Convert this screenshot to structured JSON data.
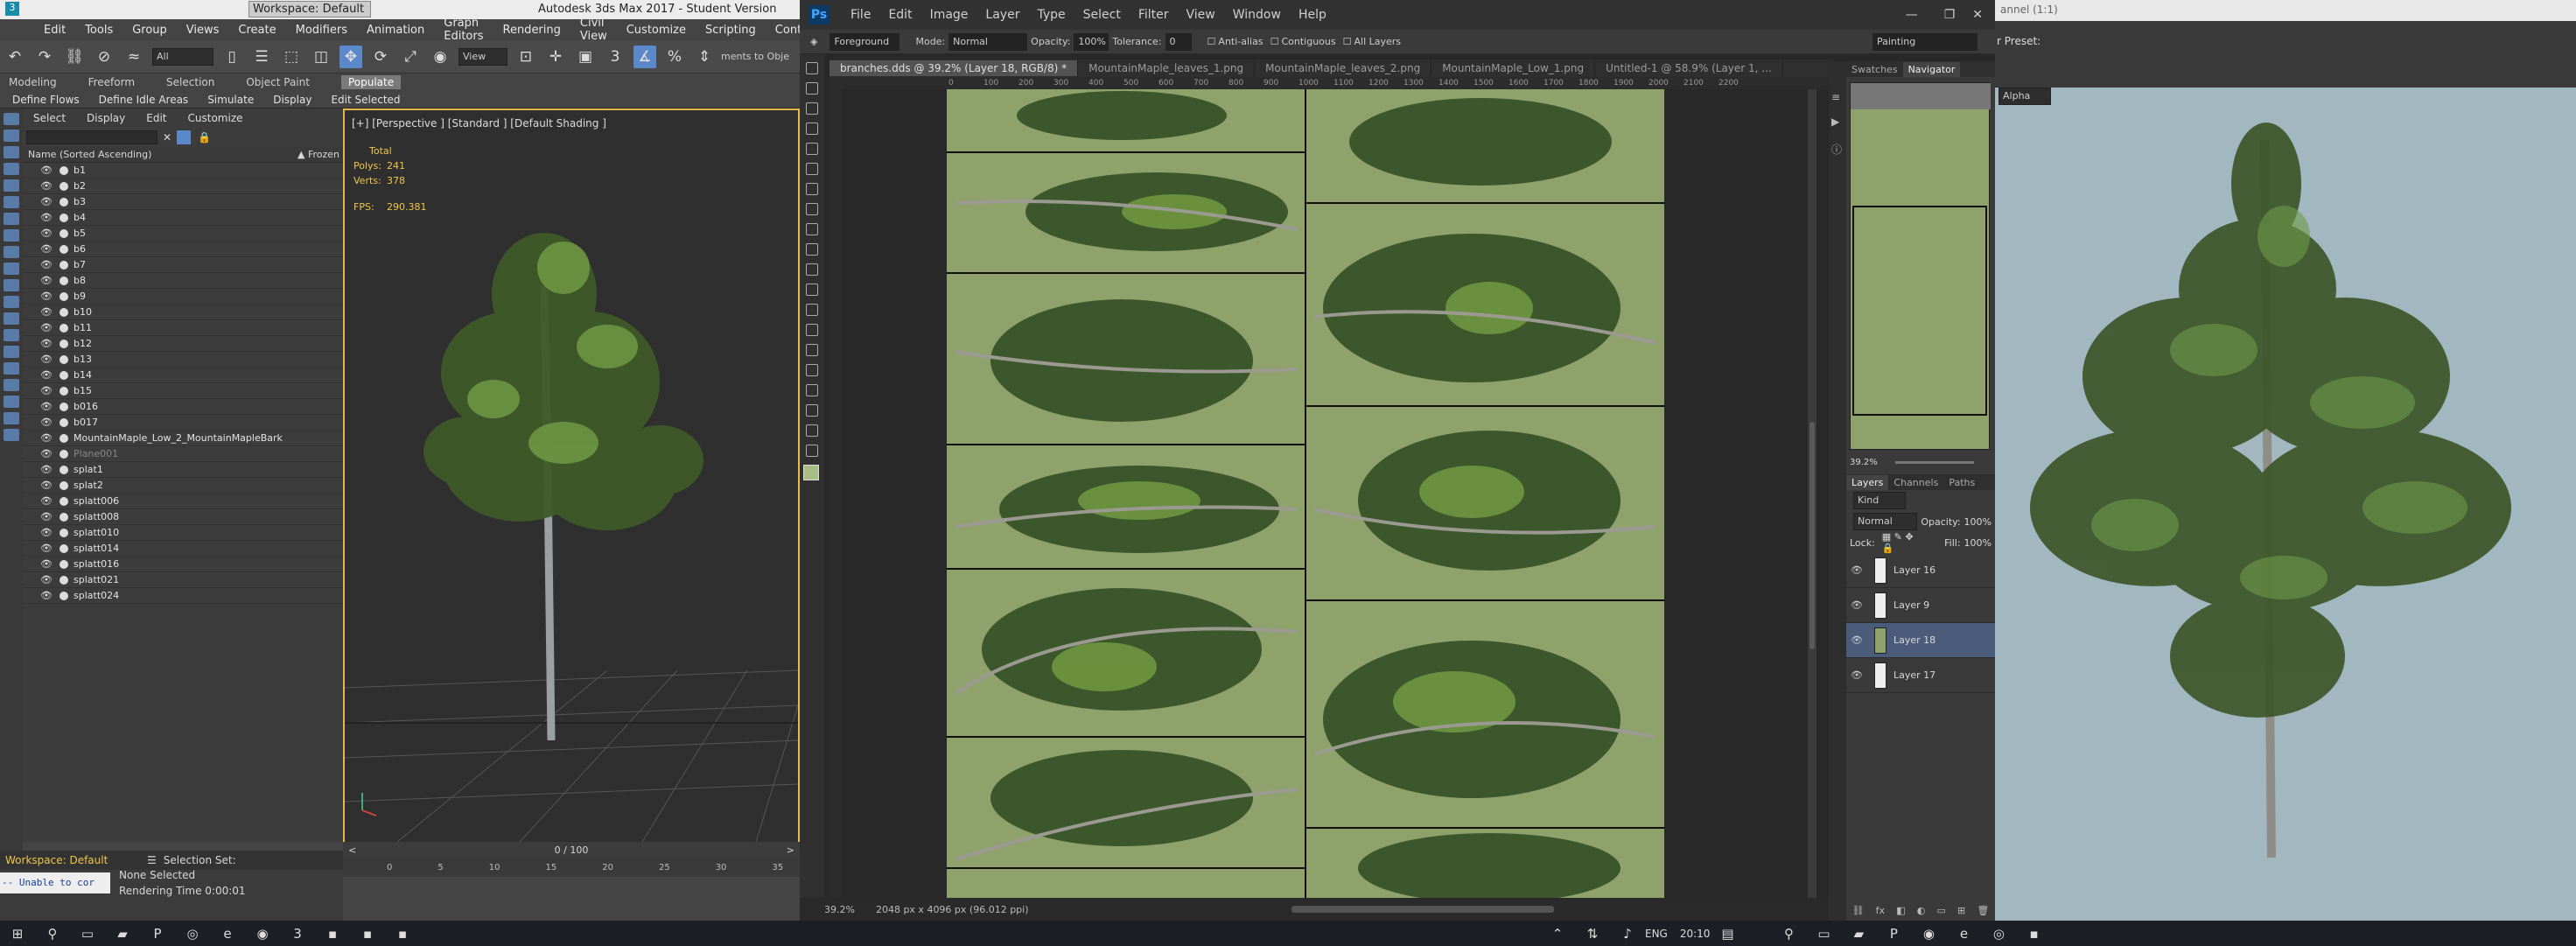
{
  "max": {
    "title": "Autodesk 3ds Max 2017 - Student Version",
    "workspace": "Workspace: Default",
    "menu": [
      "Edit",
      "Tools",
      "Group",
      "Views",
      "Create",
      "Modifiers",
      "Animation",
      "Graph Editors",
      "Rendering",
      "Civil View",
      "Customize",
      "Scripting",
      "Content"
    ],
    "toolbar": {
      "filter_value": "All",
      "view_value": "View",
      "selection_hint": "ments to Obje"
    },
    "ribbon_tabs": [
      "Modeling",
      "Freeform",
      "Selection",
      "Object Paint",
      "Populate"
    ],
    "ribbon_commands": [
      "Define Flows",
      "Define Idle Areas",
      "Simulate",
      "Display",
      "Edit Selected"
    ],
    "scene_menu": [
      "Select",
      "Display",
      "Edit",
      "Customize"
    ],
    "scene_header": {
      "name": "Name (Sorted Ascending)",
      "frozen": "▲ Frozen"
    },
    "scene_items": [
      "b1",
      "b2",
      "b3",
      "b4",
      "b5",
      "b6",
      "b7",
      "b8",
      "b9",
      "b10",
      "b11",
      "b12",
      "b13",
      "b14",
      "b15",
      "b016",
      "b017",
      "MountainMaple_Low_2_MountainMapleBark",
      "Plane001",
      "splat1",
      "splat2",
      "splatt006",
      "splatt008",
      "splatt010",
      "splatt014",
      "splatt016",
      "splatt021",
      "splatt024"
    ],
    "viewport_label": "[+] [Perspective ] [Standard ] [Default Shading ]",
    "stats": {
      "total": "Total",
      "polys_label": "Polys:",
      "polys": "241",
      "verts_label": "Verts:",
      "verts": "378",
      "fps_label": "FPS:",
      "fps": "290.381"
    },
    "timeline": "0 / 100",
    "ruler_ticks": [
      "0",
      "5",
      "10",
      "15",
      "20",
      "25",
      "30",
      "35"
    ],
    "status": {
      "workspace": "Workspace: Default",
      "selection_set": "Selection Set:",
      "none_selected": "None Selected",
      "error": "-- Unable to cor",
      "render_time": "Rendering Time  0:00:01"
    }
  },
  "ps": {
    "logo": "Ps",
    "menu": [
      "File",
      "Edit",
      "Image",
      "Layer",
      "Type",
      "Select",
      "Filter",
      "View",
      "Window",
      "Help"
    ],
    "options": {
      "mode_label": "Foreground",
      "mode": "Mode:",
      "mode_value": "Normal",
      "opacity_label": "Opacity:",
      "opacity": "100%",
      "tolerance_label": "Tolerance:",
      "tolerance": "0",
      "anti_alias": "Anti-alias",
      "contiguous": "Contiguous",
      "all_layers": "All Layers",
      "workspace": "Painting"
    },
    "tabs": [
      "branches.dds @ 39.2% (Layer 18, RGB/8) *",
      "MountainMaple_leaves_1.png",
      "MountainMaple_leaves_2.png",
      "MountainMaple_Low_1.png",
      "Untitled-1 @ 58.9% (Layer 1, ..."
    ],
    "hruler": [
      "0",
      "100",
      "200",
      "300",
      "400",
      "500",
      "600",
      "700",
      "800",
      "900",
      "1000",
      "1100",
      "1200",
      "1300",
      "1400",
      "1500",
      "1600",
      "1700",
      "1800",
      "1900",
      "2000",
      "2100",
      "2200"
    ],
    "status_zoom": "39.2%",
    "status_doc": "2048 px x 4096 px (96.012 ppi)",
    "nav_tabs": [
      "Swatches",
      "Navigator"
    ],
    "nav_zoom": "39.2%",
    "layer_tabs": [
      "Layers",
      "Channels",
      "Paths"
    ],
    "kind": "Kind",
    "blend": "Normal",
    "opacity_label": "Opacity:",
    "opacity": "100%",
    "lock_label": "Lock:",
    "fill_label": "Fill:",
    "fill": "100%",
    "layers": [
      {
        "name": "Layer 16",
        "selected": false
      },
      {
        "name": "Layer 9",
        "selected": false
      },
      {
        "name": "Layer 18",
        "selected": true
      },
      {
        "name": "Layer 17",
        "selected": false
      }
    ]
  },
  "preview": {
    "title": "annel (1:1)",
    "preset": "r Preset:",
    "alpha": "Alpha"
  },
  "taskbar": {
    "lang": "ENG",
    "time": "20:10"
  }
}
